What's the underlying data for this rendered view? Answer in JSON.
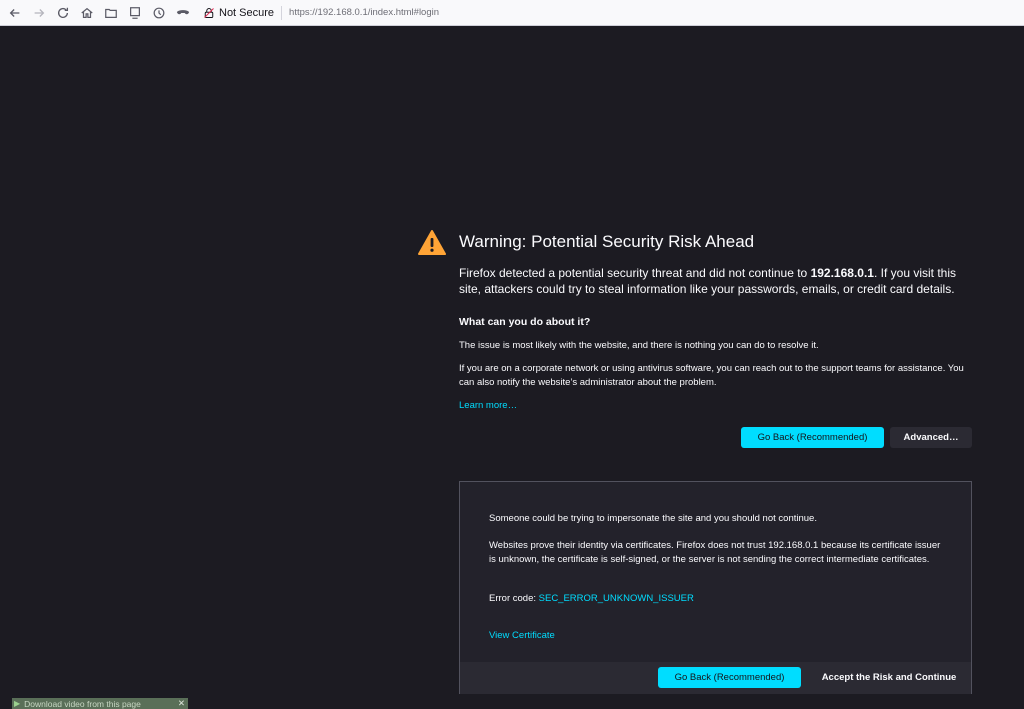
{
  "toolbar": {
    "security_label": "Not Secure",
    "url": "https://192.168.0.1/index.html#login"
  },
  "page": {
    "title": "Warning: Potential Security Risk Ahead",
    "intro_before": "Firefox detected a potential security threat and did not continue to ",
    "intro_host": "192.168.0.1",
    "intro_after": ". If you visit this site, attackers could try to steal information like your passwords, emails, or credit card details.",
    "what_heading": "What can you do about it?",
    "para1": "The issue is most likely with the website, and there is nothing you can do to resolve it.",
    "para2": "If you are on a corporate network or using antivirus software, you can reach out to the support teams for assistance. You can also notify the website’s administrator about the problem.",
    "learn_more": "Learn more…",
    "go_back_label": "Go Back (Recommended)",
    "advanced_label": "Advanced…"
  },
  "advanced": {
    "line1": "Someone could be trying to impersonate the site and you should not continue.",
    "line2": "Websites prove their identity via certificates. Firefox does not trust 192.168.0.1 because its certificate issuer is unknown, the certificate is self-signed, or the server is not sending the correct intermediate certificates.",
    "error_prefix": "Error code: ",
    "error_code": "SEC_ERROR_UNKNOWN_ISSUER",
    "view_certificate": "View Certificate",
    "go_back_label": "Go Back (Recommended)",
    "accept_label": "Accept the Risk and Continue"
  },
  "download_bar": {
    "label": "Download video from this page"
  },
  "colors": {
    "background": "#1c1b22",
    "accent": "#00ddff",
    "warning": "#ffa436"
  }
}
